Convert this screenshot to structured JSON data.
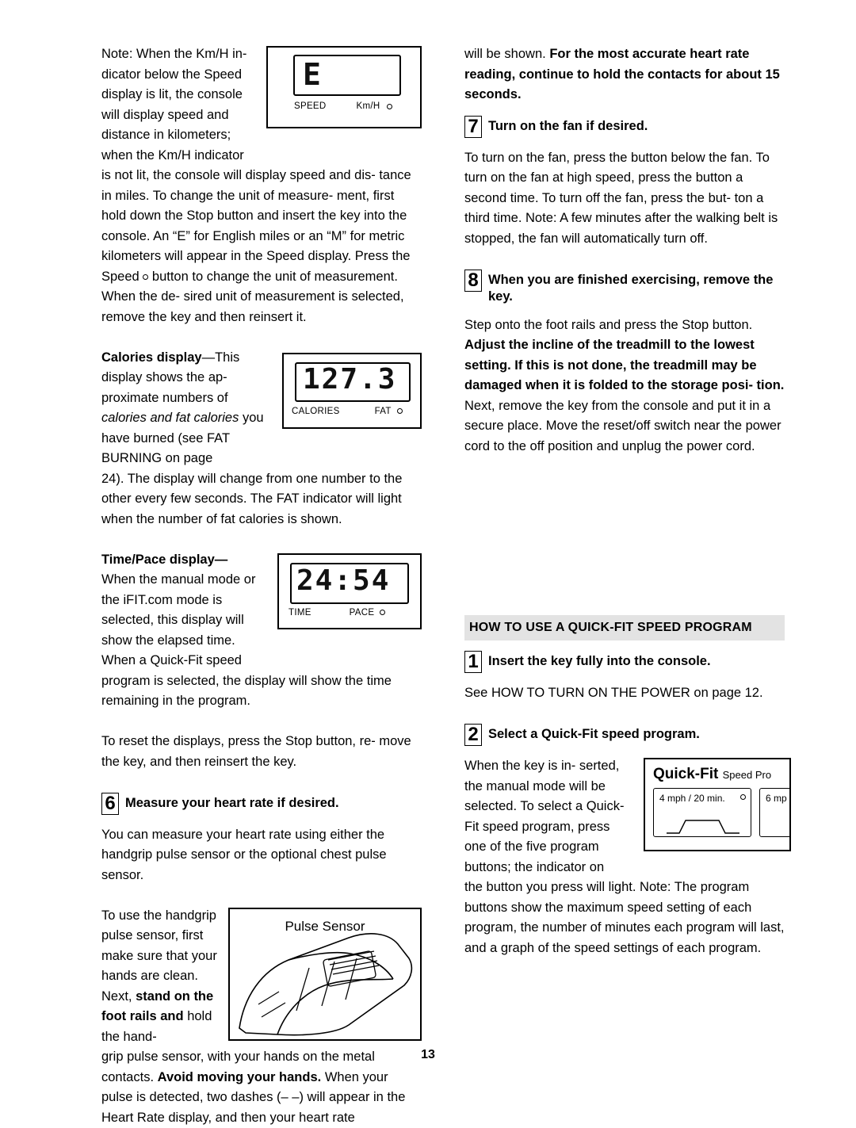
{
  "page_number": "13",
  "left_column": {
    "note_paragraph_1": "Note: When the Km/H in- dicator below the Speed display is lit, the console will display speed and distance in kilometers; when the Km/H indicator",
    "note_paragraph_2": "is not lit, the console will display speed and dis- tance in miles. To change the unit of measure- ment, first hold down the Stop button and insert the key into the console. An “E” for English miles or an “M” for metric kilometers will appear in the Speed display. Press the Speed",
    "note_paragraph_2_tail": "button to change the unit of measurement. When the de- sired unit of measurement is selected, remove the key and then reinsert it.",
    "speed_figure": {
      "segment_value": "E",
      "label_speed": "SPEED",
      "label_kmh": "Km/H"
    },
    "calories_heading": "Calories display",
    "calories_heading_dash": "—This",
    "calories_text_1": "display shows the ap- proximate numbers of",
    "calories_text_italic": "calories and fat calories",
    "calories_text_2": "you have burned (see FAT BURNING on page",
    "calories_text_3": "24). The display will change from one number to the other every few seconds. The FAT indicator will light when the number of fat calories is shown.",
    "calories_figure": {
      "segment_value": "127.3",
      "label_calories": "CALORIES",
      "label_fat": "FAT"
    },
    "timepace_heading": "Time/Pace display—",
    "timepace_text_1": "When the manual mode or the iFIT.com mode is selected, this display will show the elapsed time. When a Quick-Fit speed",
    "timepace_text_2": "program is selected, the display will show the time remaining in the program.",
    "timepace_figure": {
      "segment_value": "24:54",
      "label_time": "TIME",
      "label_pace": "PACE"
    },
    "reset_paragraph": "To reset the displays, press the Stop button, re- move the key, and then reinsert the key.",
    "step6_number": "6",
    "step6_title": "Measure your heart rate if desired.",
    "step6_text_1": "You can measure your heart rate using either the handgrip pulse sensor or the optional chest pulse sensor.",
    "step6_text_2": "To use the handgrip pulse sensor, first make sure that your hands are clean. Next,",
    "step6_bold_1": "stand on the",
    "step6_bold_2": "foot rails and",
    "step6_text_3": "hold the hand-",
    "step6_text_4": "grip pulse sensor, with your hands on the metal contacts.",
    "step6_bold_3": "Avoid moving your hands.",
    "step6_text_5": "When your pulse is detected, two dashes (– –) will appear in the Heart Rate display, and then your heart rate",
    "pulse_figure_caption": "Pulse Sensor"
  },
  "right_column": {
    "continued_text": "will be shown.",
    "continued_bold": "For the most accurate heart rate reading, continue to hold the contacts for about 15 seconds.",
    "step7_number": "7",
    "step7_title": "Turn on the fan if desired.",
    "step7_text": "To turn on the fan, press the button below the fan. To turn on the fan at high speed, press the button a second time. To turn off the fan, press the but- ton a third time. Note: A few minutes after the walking belt is stopped, the fan will automatically turn off.",
    "step8_number": "8",
    "step8_title": "When you are finished exercising, remove the key.",
    "step8_text_1": "Step onto the foot rails and press the Stop button.",
    "step8_bold": "Adjust the incline of the treadmill to the lowest setting. If this is not done, the treadmill may be damaged when it is folded to the storage posi- tion.",
    "step8_text_2": "Next, remove the key from the console and put it in a secure place. Move the reset/off switch near the power cord to the off position and unplug the power cord.",
    "section_header": "HOW TO USE A QUICK-FIT SPEED PROGRAM",
    "qf_step1_number": "1",
    "qf_step1_title": "Insert the key fully into the console.",
    "qf_step1_text": "See HOW TO TURN ON THE POWER on page 12.",
    "qf_step2_number": "2",
    "qf_step2_title": "Select a Quick-Fit speed program.",
    "qf_step2_text_1": "When the key is in- serted, the manual mode will be selected. To select a Quick-Fit speed program, press one of the five program buttons; the indicator on",
    "qf_step2_text_2": "the button you press will light. Note: The program buttons show the maximum speed setting of each program, the number of minutes each program will last, and a graph of the speed settings of each program.",
    "quickfit_figure": {
      "title": "Quick-Fit",
      "subtitle": "Speed Pro",
      "button1_label": "4 mph / 20 min.",
      "button2_label": "6 mp"
    }
  }
}
